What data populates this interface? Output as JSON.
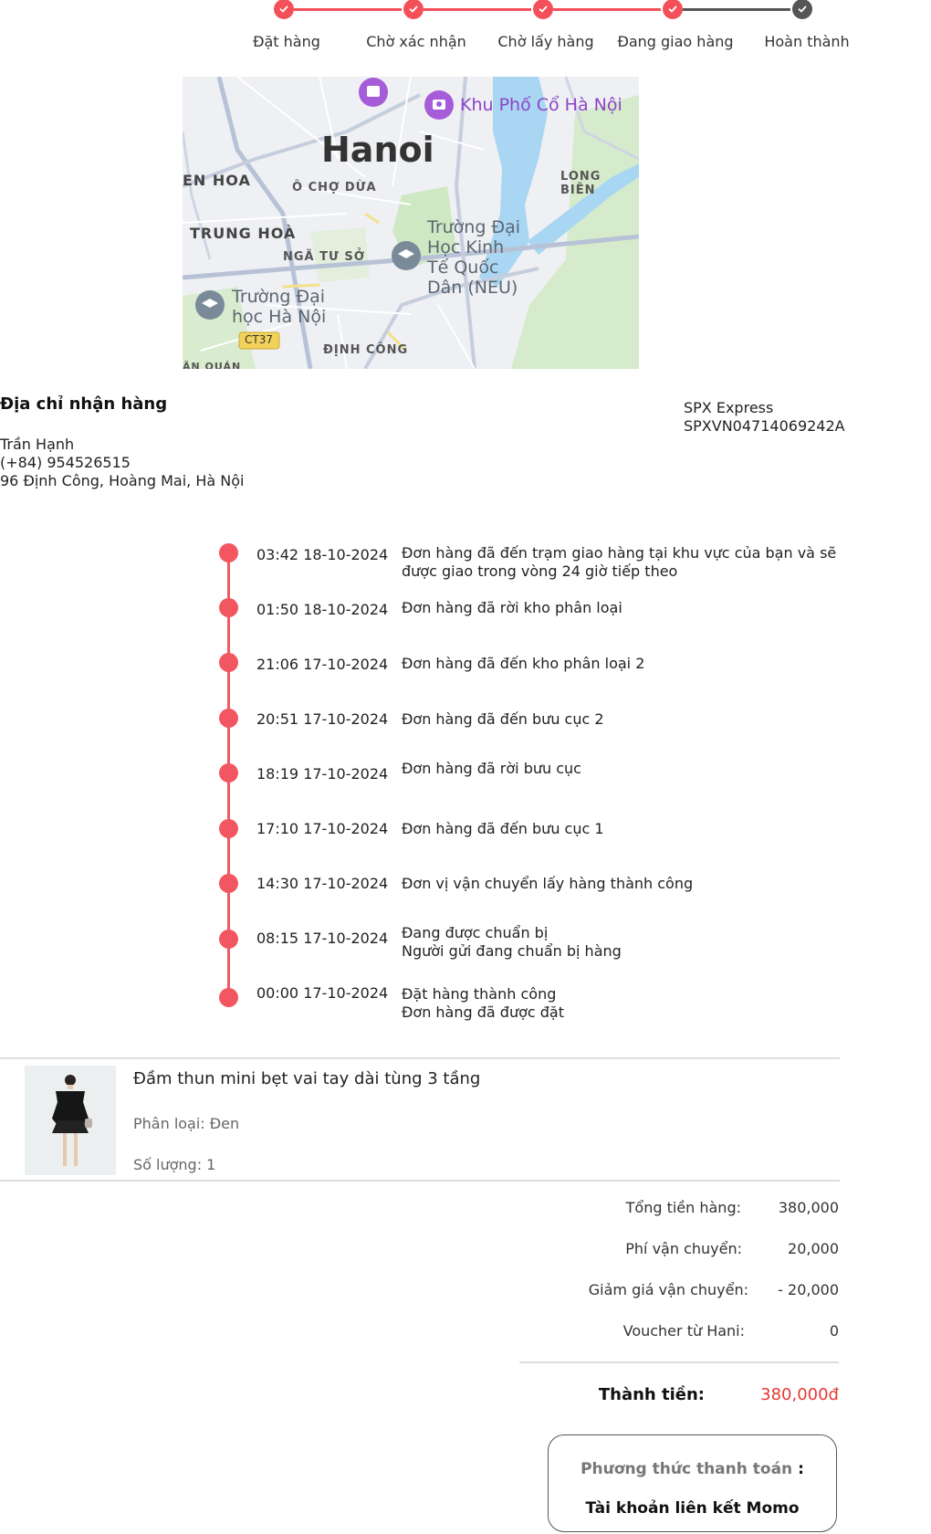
{
  "stepper": {
    "steps": [
      {
        "label": "Đặt hàng",
        "done": true
      },
      {
        "label": "Chờ xác nhận",
        "done": true
      },
      {
        "label": "Chờ lấy hàng",
        "done": true
      },
      {
        "label": "Đang giao hàng",
        "done": true
      },
      {
        "label": "Hoàn thành",
        "done": false
      }
    ],
    "active_color": "#f4505a",
    "inactive_color": "#555555"
  },
  "map": {
    "city": "Hanoi",
    "labels": {
      "en_hoa": "EN HOA",
      "o_cho_dua": "Ô CHỢ DỪA",
      "long_bien": "LONG BIÊN",
      "trung_hoa": "TRUNG HOÀ",
      "nga_tu_so": "NGÃ TƯ SỞ",
      "dinh_cong": "ĐỊNH CÔNG",
      "an_quan": "ĂN QUÁN",
      "road_badge": "CT37"
    },
    "pois": {
      "old_quarter": "Khu Phố Cổ Hà Nội",
      "neu_line1": "Trường Đại",
      "neu_line2": "Học Kinh",
      "neu_line3": "Tế Quốc",
      "neu_line4": "Dân (NEU)",
      "hnu_line1": "Trường Đại",
      "hnu_line2": "học Hà Nội"
    }
  },
  "address": {
    "title": "Địa chỉ nhận hàng",
    "name": "Trần Hạnh",
    "phone": "(+84) 954526515",
    "street": "96 Định Công, Hoàng Mai, Hà Nội"
  },
  "carrier": {
    "name": "SPX Express",
    "tracking": "SPXVN04714069242A"
  },
  "timeline": [
    {
      "time": "03:42 18-10-2024",
      "line1": "Đơn hàng đã đến trạm giao hàng tại khu vực của bạn và sẽ",
      "line2": "được giao trong vòng 24 giờ tiếp theo"
    },
    {
      "time": "01:50 18-10-2024",
      "line1": "Đơn hàng đã rời kho phân loại",
      "line2": ""
    },
    {
      "time": "21:06 17-10-2024",
      "line1": "Đơn hàng đã đến kho phân loại 2",
      "line2": ""
    },
    {
      "time": "20:51 17-10-2024",
      "line1": "Đơn hàng đã đến bưu cục 2",
      "line2": ""
    },
    {
      "time": "18:19 17-10-2024",
      "line1": "Đơn hàng đã rời bưu cục",
      "line2": ""
    },
    {
      "time": "17:10 17-10-2024",
      "line1": "Đơn hàng đã đến bưu cục 1",
      "line2": ""
    },
    {
      "time": "14:30 17-10-2024",
      "line1": "Đơn vị vận chuyển lấy hàng thành công",
      "line2": ""
    },
    {
      "time": "08:15 17-10-2024",
      "line1": "Đang được chuẩn bị",
      "line2": "Người gửi đang chuẩn bị hàng"
    },
    {
      "time": "00:00 17-10-2024",
      "line1": "Đặt hàng thành công",
      "line2": "Đơn hàng đã được đặt"
    }
  ],
  "product": {
    "name": "Đầm thun mini bẹt vai tay dài tùng 3 tầng",
    "variant": "Phân loại: Đen",
    "quantity": "Số lượng: 1"
  },
  "summary": {
    "subtotal_label": "Tổng tiền hàng:",
    "subtotal_value": "380,000",
    "shipping_label": "Phí vận chuyển:",
    "shipping_value": "20,000",
    "ship_discount_label": "Giảm giá vận chuyển:",
    "ship_discount_value": "- 20,000",
    "voucher_label": "Voucher từ Hani:",
    "voucher_value": "0",
    "total_label": "Thành tiền:",
    "total_value": "380,000đ"
  },
  "payment": {
    "title": "Phương thức thanh toán",
    "colon": ":",
    "method": "Tài khoản liên kết Momo"
  },
  "colors": {
    "accent": "#f4505a",
    "timeline": "#f25660",
    "total": "#e53935"
  }
}
